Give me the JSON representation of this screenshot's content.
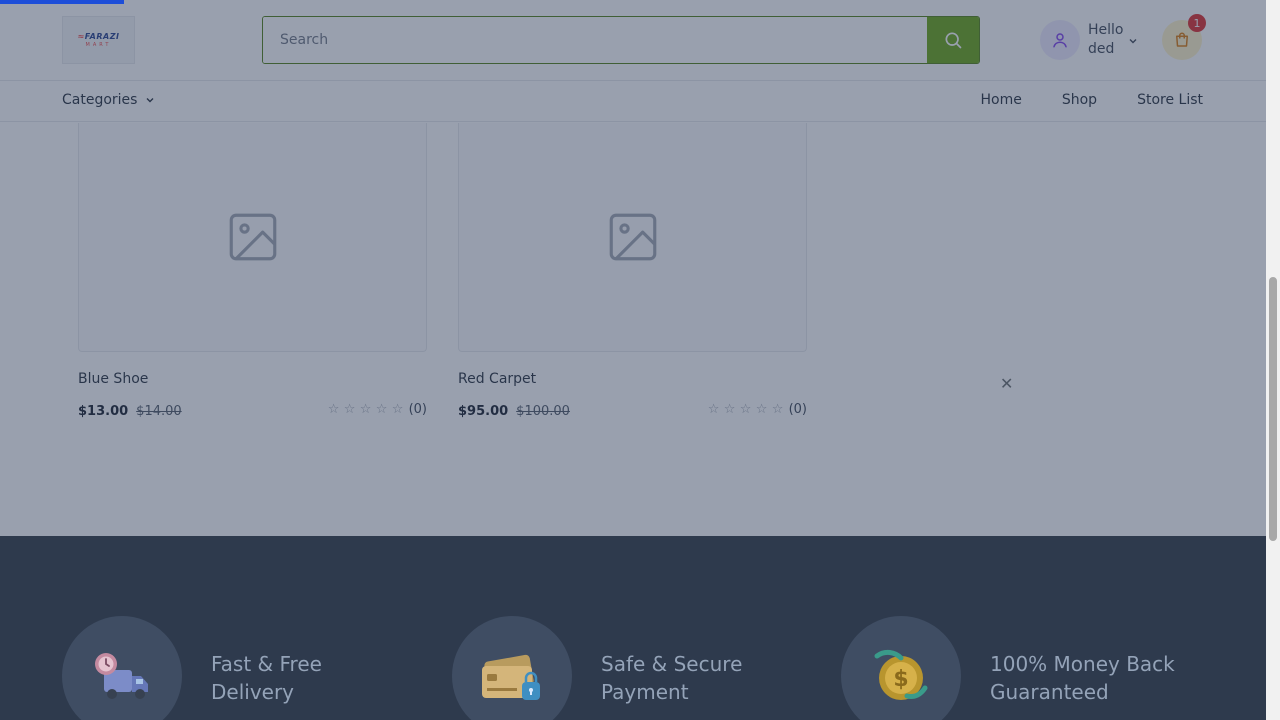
{
  "header": {
    "logo_top": "FARAZI",
    "logo_bottom": "MART",
    "search_placeholder": "Search",
    "user_greeting": "Hello",
    "user_name": "ded",
    "cart_count": "1"
  },
  "nav": {
    "categories_label": "Categories",
    "links": [
      "Home",
      "Shop",
      "Store List"
    ]
  },
  "products": [
    {
      "name": "Blue Shoe",
      "price": "$13.00",
      "old_price": "$14.00",
      "rating": 0,
      "reviews": "(0)"
    },
    {
      "name": "Red Carpet",
      "price": "$95.00",
      "old_price": "$100.00",
      "rating": 0,
      "reviews": "(0)"
    }
  ],
  "features": [
    {
      "line1": "Fast & Free",
      "line2": "Delivery",
      "icon": "delivery-truck-icon"
    },
    {
      "line1": "Safe & Secure",
      "line2": "Payment",
      "icon": "credit-card-icon"
    },
    {
      "line1": "100% Money Back",
      "line2": "Guaranteed",
      "icon": "money-coin-icon"
    }
  ],
  "modal": {
    "close_symbol": "✕"
  },
  "colors": {
    "accent_green": "#65a30d",
    "footer_bg": "#2e3a4d",
    "badge_red": "#dc2626"
  }
}
